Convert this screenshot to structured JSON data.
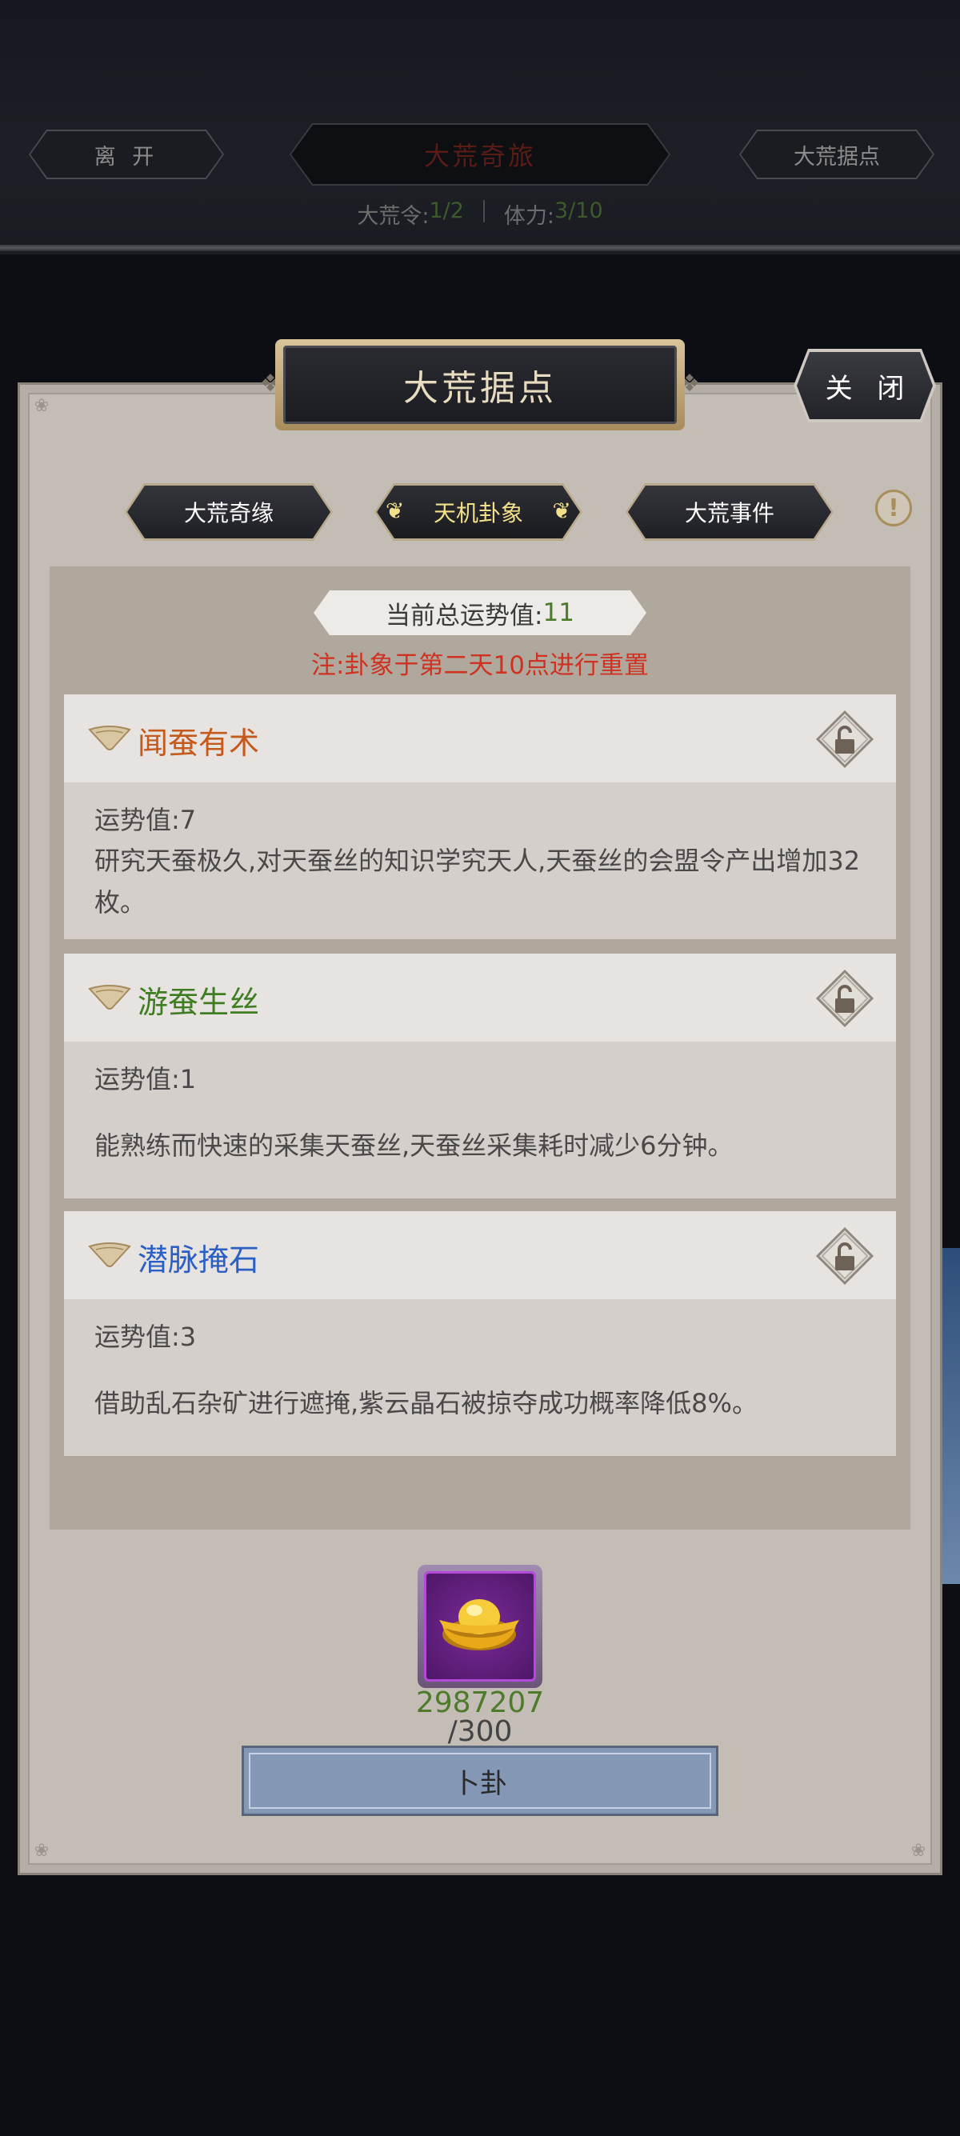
{
  "topbar": {
    "leave_label": "离 开",
    "title": "大荒奇旅",
    "stronghold_label": "大荒据点",
    "token_label": "大荒令:",
    "token_value": "1/2",
    "stamina_label": "体力:",
    "stamina_value": "3/10"
  },
  "dialog": {
    "title": "大荒据点",
    "close_label": "关 闭",
    "tabs": [
      {
        "label": "大荒奇缘",
        "active": false
      },
      {
        "label": "天机卦象",
        "active": true
      },
      {
        "label": "大荒事件",
        "active": false
      }
    ],
    "score_label": "当前总运势值:",
    "score_value": "11",
    "reset_note": "注:卦象于第二天10点进行重置",
    "cards": [
      {
        "title": "闻蚕有术",
        "title_color": "#c55a1c",
        "fortune": "运势值:7",
        "desc": "研究天蚕极久,对天蚕丝的知识学究天人,天蚕丝的会盟令产出增加32枚。"
      },
      {
        "title": "游蚕生丝",
        "title_color": "#3f7d22",
        "fortune": "运势值:1",
        "desc": "能熟练而快速的采集天蚕丝,天蚕丝采集耗时减少6分钟。"
      },
      {
        "title": "潜脉掩石",
        "title_color": "#2c5fc4",
        "fortune": "运势值:3",
        "desc": "借助乱石杂矿进行遮掩,紫云晶石被掠夺成功概率降低8%。"
      }
    ],
    "cost_item_icon": "gold-ingot-icon",
    "cost_owned": "2987207",
    "cost_required": "/300",
    "divine_button_label": "卜卦"
  }
}
